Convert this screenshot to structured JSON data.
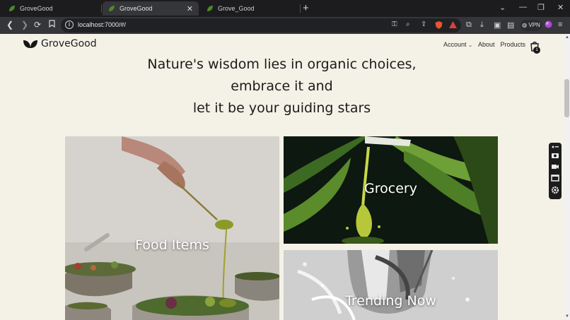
{
  "browser": {
    "tabs": [
      {
        "title": "GroveGood",
        "active": false
      },
      {
        "title": "GroveGood",
        "active": true
      },
      {
        "title": "Grove_Good",
        "active": false
      }
    ],
    "url": "localhost:7000/#/",
    "vpn_label": "VPN"
  },
  "site": {
    "brand": "GroveGood",
    "nav": {
      "account": "Account",
      "about": "About",
      "products": "Products"
    },
    "cart_count": "1"
  },
  "hero": {
    "line1": "Nature's wisdom lies in organic choices,",
    "line2": "embrace it and",
    "line3": "let it be your guiding stars"
  },
  "categories": {
    "food": "Food Items",
    "grocery": "Grocery",
    "trending": "Trending Now"
  },
  "colors": {
    "page_bg": "#f4f1e6",
    "tab_bg": "#1c1c1f",
    "toolbar_bg": "#35363a",
    "leaf_green": "#4a8a2a"
  }
}
